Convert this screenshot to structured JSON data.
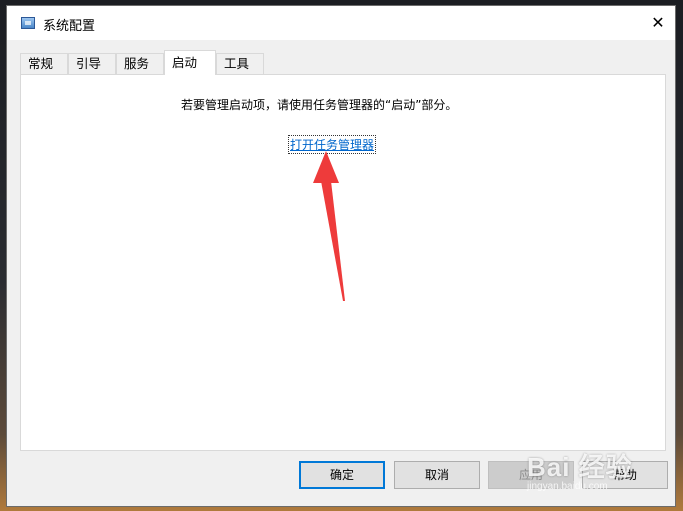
{
  "window": {
    "title": "系统配置",
    "close_glyph": "✕"
  },
  "tabs": [
    {
      "label": "常规",
      "active": false
    },
    {
      "label": "引导",
      "active": false
    },
    {
      "label": "服务",
      "active": false
    },
    {
      "label": "启动",
      "active": true
    },
    {
      "label": "工具",
      "active": false
    }
  ],
  "panel": {
    "hint": "若要管理启动项，请使用任务管理器的“启动”部分。",
    "link": "打开任务管理器",
    "annotation_color": "#ee3b3b"
  },
  "buttons": {
    "ok": "确定",
    "cancel": "取消",
    "apply": "应用",
    "help": "帮助"
  },
  "watermark": {
    "brand": "Bai 经验",
    "site": "jingyan.baidu.com"
  },
  "colors": {
    "link": "#0066cc",
    "focus_border": "#0078d7"
  }
}
